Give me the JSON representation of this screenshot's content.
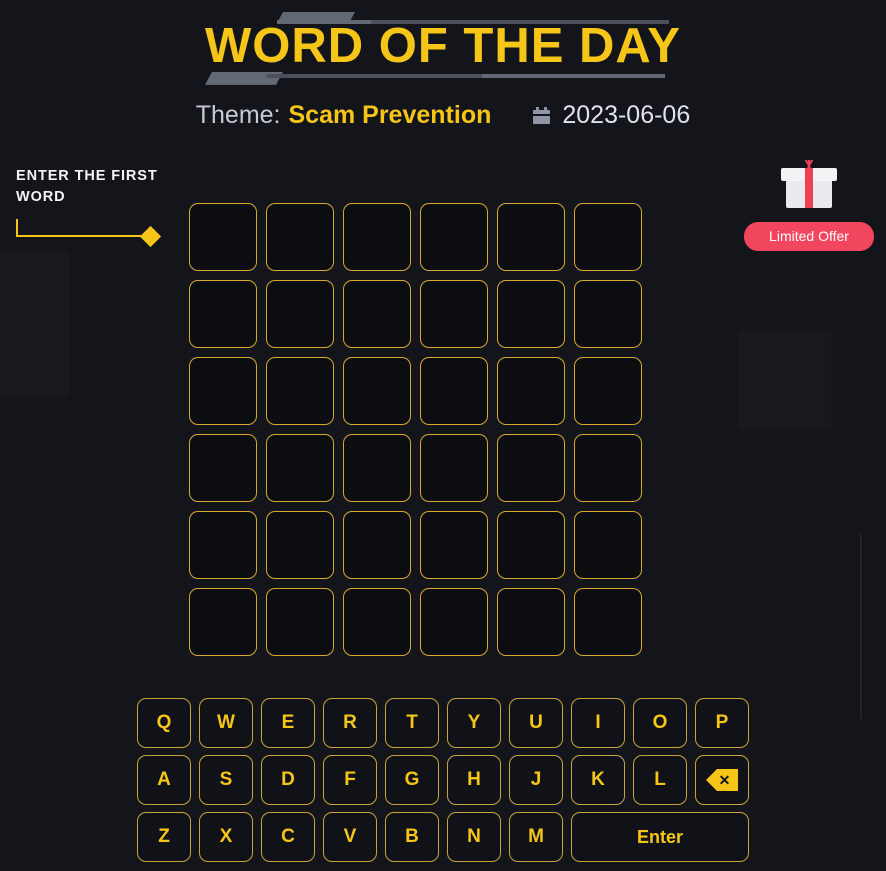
{
  "header": {
    "title": "WORD OF THE DAY",
    "theme_label": "Theme:",
    "theme_value": "Scam Prevention",
    "calendar_icon": "calendar-icon",
    "date": "2023-06-06"
  },
  "hint": {
    "text": "ENTER THE FIRST WORD",
    "accent_color": "#f5c518"
  },
  "promo": {
    "gift_icon": "gift-box-icon",
    "badge_label": "Limited Offer",
    "badge_color": "#f2455e"
  },
  "board": {
    "rows": 6,
    "columns": 6,
    "cell_border_color": "#d7a932",
    "cells": [
      [
        "",
        "",
        "",
        "",
        "",
        ""
      ],
      [
        "",
        "",
        "",
        "",
        "",
        ""
      ],
      [
        "",
        "",
        "",
        "",
        "",
        ""
      ],
      [
        "",
        "",
        "",
        "",
        "",
        ""
      ],
      [
        "",
        "",
        "",
        "",
        "",
        ""
      ],
      [
        "",
        "",
        "",
        "",
        "",
        ""
      ]
    ]
  },
  "keyboard": {
    "accent_color": "#f5c518",
    "rows": [
      [
        "Q",
        "W",
        "E",
        "R",
        "T",
        "Y",
        "U",
        "I",
        "O",
        "P"
      ],
      [
        "A",
        "S",
        "D",
        "F",
        "G",
        "H",
        "J",
        "K",
        "L",
        "BACKSPACE"
      ],
      [
        "Z",
        "X",
        "C",
        "V",
        "B",
        "N",
        "M",
        "Enter"
      ]
    ],
    "backspace_icon": "backspace-icon",
    "enter_label": "Enter"
  },
  "theme_colors": {
    "background": "#14151a",
    "gold": "#f5c518",
    "panel": "#1b1c23"
  }
}
